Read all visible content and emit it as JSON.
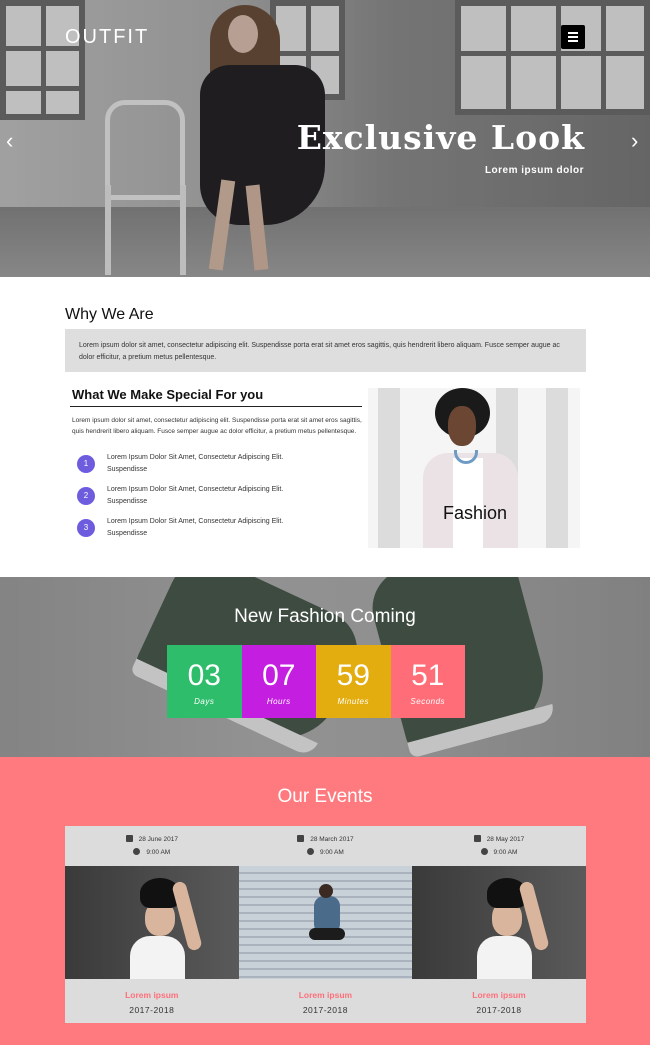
{
  "header": {
    "logo": "OUTFIT",
    "menu_icon": "hamburger-menu-icon",
    "prev_icon": "chevron-left-icon",
    "next_icon": "chevron-right-icon"
  },
  "hero": {
    "title": "Exclusive Look",
    "subtitle": "Lorem ipsum dolor"
  },
  "why": {
    "title": "Why We Are",
    "text": "Lorem ipsum dolor sit amet, consectetur adipiscing elit. Suspendisse porta erat sit amet eros sagittis, quis hendrerit libero aliquam. Fusce semper augue ac dolor efficitur, a pretium metus pellentesque."
  },
  "special": {
    "title": "What We Make Special For you",
    "text": "Lorem ipsum dolor sit amet, consectetur adipiscing elit. Suspendisse porta erat sit amet eros sagittis, quis hendrerit libero aliquam. Fusce semper augue ac dolor efficitur, a pretium metus pellentesque.",
    "steps": [
      {
        "num": "1",
        "text": "Lorem Ipsum Dolor Sit Amet, Consectetur Adipiscing Elit. Suspendisse"
      },
      {
        "num": "2",
        "text": "Lorem Ipsum Dolor Sit Amet, Consectetur Adipiscing Elit. Suspendisse"
      },
      {
        "num": "3",
        "text": "Lorem Ipsum Dolor Sit Amet, Consectetur Adipiscing Elit. Suspendisse"
      }
    ],
    "image_label": "Fashion"
  },
  "countdown": {
    "title": "New Fashion Coming",
    "items": [
      {
        "value": "03",
        "label": "Days",
        "color": "#2ebd6b"
      },
      {
        "value": "07",
        "label": "Hours",
        "color": "#c41fe0"
      },
      {
        "value": "59",
        "label": "Minutes",
        "color": "#e3ad0f"
      },
      {
        "value": "51",
        "label": "Seconds",
        "color": "#ff6e78"
      }
    ]
  },
  "events": {
    "title": "Our Events",
    "accent": "#ff7a7f",
    "items": [
      {
        "date": "28 June 2017",
        "time": "9:00 AM",
        "name": "Lorem ipsum",
        "year": "2017-2018"
      },
      {
        "date": "28 March 2017",
        "time": "9:00 AM",
        "name": "Lorem ipsum",
        "year": "2017-2018"
      },
      {
        "date": "28 May 2017",
        "time": "9:00 AM",
        "name": "Lorem ipsum",
        "year": "2017-2018"
      }
    ]
  }
}
